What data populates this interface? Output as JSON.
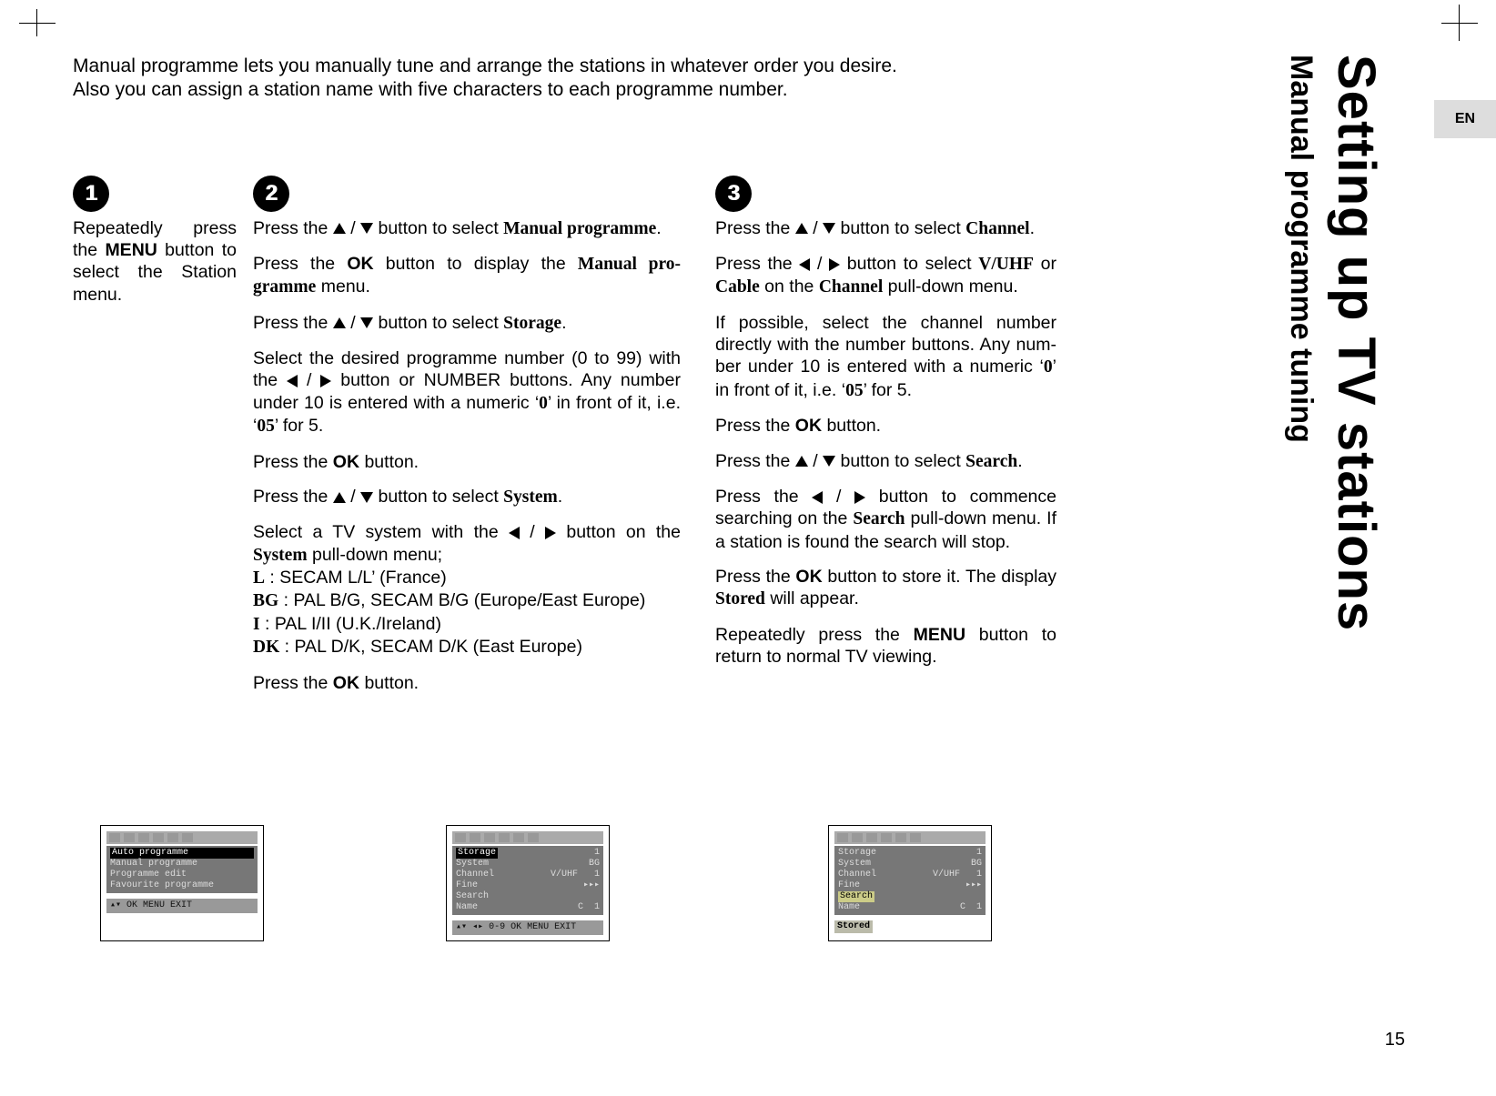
{
  "language_tab": "EN",
  "page_number": "15",
  "title_main": "Setting up TV stations",
  "title_sub": "Manual programme tuning",
  "intro_line1": "Manual programme lets you manually tune and arrange the stations in whatever order you desire.",
  "intro_line2": "Also you can assign a station name with five characters to each programme number.",
  "step_numbers": {
    "s1": "1",
    "s2": "2",
    "s3": "3"
  },
  "step1": {
    "p1_a": "Repeatedly press the ",
    "p1_menu": "MENU",
    "p1_b": " button to select the Station menu."
  },
  "step2": {
    "p1_a": "Press the ",
    "p1_b": " button to select ",
    "p1_manual": "Manual pro­gramme",
    "p1_c": ".",
    "p2_a": "Press the ",
    "p2_ok": "OK",
    "p2_b": " button to display the ",
    "p2_manual": "Manual pro­gramme",
    "p2_c": " menu.",
    "p3_a": "Press the ",
    "p3_b": " button to select ",
    "p3_storage": "Storage",
    "p3_c": ".",
    "p4_a": "Select the desired programme number (0 to 99) with the ",
    "p4_b": " button or NUMBER buttons. Any number under 10 is entered with a numeric ‘",
    "p4_zero": "0",
    "p4_c": "’ in front of it, i.e. ‘",
    "p4_05": "05",
    "p4_d": "’  for 5.",
    "p5_a": "Press the ",
    "p5_ok": "OK",
    "p5_b": " button.",
    "p6_a": "Press the ",
    "p6_b": " button to select ",
    "p6_system": "System",
    "p6_c": ".",
    "p7_a": "Select a TV system with the ",
    "p7_b": " button on the ",
    "p7_system": "System",
    "p7_c": " pull-down menu;",
    "sys_L_label": "L",
    "sys_L_txt": " : SECAM L/L’ (France)",
    "sys_BG_label": "BG",
    "sys_BG_txt": " : PAL B/G, SECAM B/G (Europe/East Europe)",
    "sys_I_label": "I",
    "sys_I_txt": " : PAL I/II (U.K./Ireland)",
    "sys_DK_label": "DK",
    "sys_DK_txt": " : PAL D/K, SECAM D/K (East Europe)",
    "p8_a": "Press the ",
    "p8_ok": "OK",
    "p8_b": " button."
  },
  "step3": {
    "p1_a": "Press the ",
    "p1_b": " button to select ",
    "p1_channel": "Channel",
    "p1_c": ".",
    "p2_a": "Press the ",
    "p2_b": " button to select ",
    "p2_vuhf": "V/UHF",
    "p2_c": " or ",
    "p2_cable": "Cable",
    "p2_d": " on the ",
    "p2_channel": "Channel",
    "p2_e": " pull-down menu.",
    "p3_a": "If possible, select the channel number directly with the number buttons. Any num­ber under 10 is entered with a numeric ‘",
    "p3_zero": "0",
    "p3_b": "’ in front of it, i.e. ‘",
    "p3_05": "05",
    "p3_c": "’ for 5.",
    "p4_a": "Press the ",
    "p4_ok": "OK",
    "p4_b": " button.",
    "p5_a": "Press the ",
    "p5_b": " button to select ",
    "p5_search": "Search",
    "p5_c": ".",
    "p6_a": "Press the ",
    "p6_b": " button to commence searching on the ",
    "p6_search": "Search",
    "p6_c": " pull-down menu. If a station is found the search will stop.",
    "p7_a": "Press the ",
    "p7_ok": "OK",
    "p7_b": " button to store it. The display ",
    "p7_stored": "Stored",
    "p7_c": " will appear.",
    "p8_a": "Repeatedly press the ",
    "p8_menu": "MENU",
    "p8_b": " button to return to normal TV viewing."
  },
  "osd1": {
    "items": [
      "Auto programme",
      "Manual programme",
      "Programme edit",
      "Favourite programme"
    ],
    "footer": "▴▾ OK MENU EXIT"
  },
  "osd2": {
    "rows": [
      {
        "l": "Storage",
        "r": "1"
      },
      {
        "l": "System",
        "r": "BG"
      },
      {
        "l": "Channel",
        "r": "V/UHF   1"
      },
      {
        "l": "Fine",
        "r": "▸▸▸"
      },
      {
        "l": "Search",
        "r": ""
      },
      {
        "l": "Name",
        "r": "C  1"
      }
    ],
    "footer": "▴▾ ◂▸ 0-9 OK MENU EXIT"
  },
  "osd3": {
    "rows": [
      {
        "l": "Storage",
        "r": "1"
      },
      {
        "l": "System",
        "r": "BG"
      },
      {
        "l": "Channel",
        "r": "V/UHF   1"
      },
      {
        "l": "Fine",
        "r": "▸▸▸"
      },
      {
        "l": "Search",
        "r": "",
        "hl": true
      },
      {
        "l": "Name",
        "r": "C  1"
      }
    ],
    "stored": "Stored"
  }
}
